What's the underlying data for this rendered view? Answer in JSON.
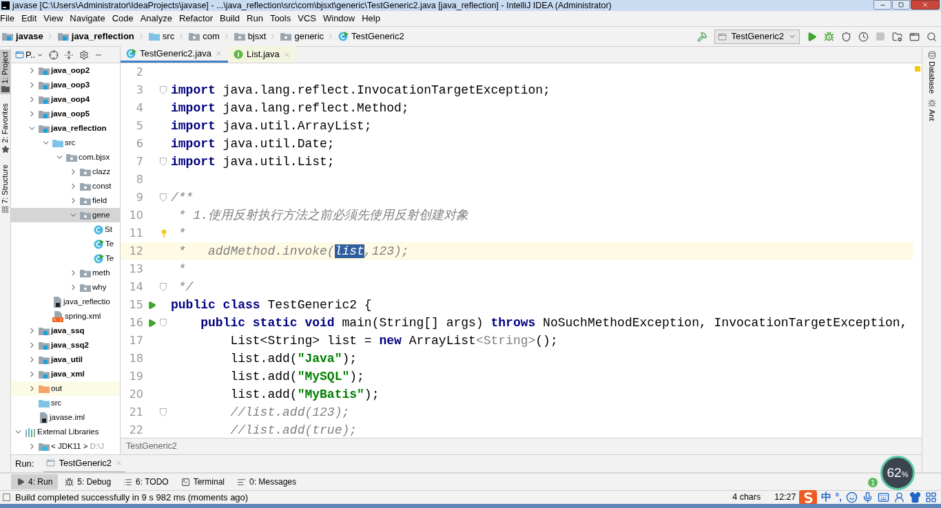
{
  "window": {
    "title": "javase [C:\\Users\\Administrator\\IdeaProjects\\javase] - ...\\java_reflection\\src\\com\\bjsxt\\generic\\TestGeneric2.java [java_reflection] - IntelliJ IDEA (Administrator)"
  },
  "menu": [
    "File",
    "Edit",
    "View",
    "Navigate",
    "Code",
    "Analyze",
    "Refactor",
    "Build",
    "Run",
    "Tools",
    "VCS",
    "Window",
    "Help"
  ],
  "breadcrumb": [
    {
      "label": "javase",
      "kind": "module"
    },
    {
      "label": "java_reflection",
      "kind": "module"
    },
    {
      "label": "src",
      "kind": "src"
    },
    {
      "label": "com",
      "kind": "package"
    },
    {
      "label": "bjsxt",
      "kind": "package"
    },
    {
      "label": "generic",
      "kind": "package"
    },
    {
      "label": "TestGeneric2",
      "kind": "class-run"
    }
  ],
  "run_config": "TestGeneric2",
  "left_tool_tabs": [
    {
      "label": "1: Project",
      "selected": true
    },
    {
      "label": "2: Favorites",
      "selected": false
    },
    {
      "label": "7: Structure",
      "selected": false
    }
  ],
  "right_tool_tabs": [
    {
      "label": "Database",
      "kind": "database"
    },
    {
      "label": "Ant",
      "kind": "ant"
    }
  ],
  "project_panel": {
    "title": "P.."
  },
  "tree": {
    "module_children": [
      {
        "label": "java_oop2",
        "kind": "module",
        "bold": true,
        "expanded": false
      },
      {
        "label": "java_oop3",
        "kind": "module",
        "bold": true,
        "expanded": false
      },
      {
        "label": "java_oop4",
        "kind": "module",
        "bold": true,
        "expanded": false
      },
      {
        "label": "java_oop5",
        "kind": "module",
        "bold": true,
        "expanded": false
      },
      {
        "label": "java_reflection",
        "kind": "module",
        "bold": true,
        "expanded": true,
        "children": [
          {
            "label": "src",
            "kind": "src",
            "expanded": true,
            "children": [
              {
                "label": "com.bjsx",
                "kind": "package",
                "expanded": true,
                "children": [
                  {
                    "label": "clazz",
                    "kind": "package",
                    "expanded": false
                  },
                  {
                    "label": "const",
                    "kind": "package",
                    "expanded": false
                  },
                  {
                    "label": "field",
                    "kind": "package",
                    "expanded": false
                  },
                  {
                    "label": "gene",
                    "kind": "package",
                    "expanded": true,
                    "selected": true,
                    "children": [
                      {
                        "label": "St",
                        "kind": "class"
                      },
                      {
                        "label": "Te",
                        "kind": "class-run"
                      },
                      {
                        "label": "Te",
                        "kind": "class-run"
                      }
                    ]
                  },
                  {
                    "label": "meth",
                    "kind": "package",
                    "expanded": false
                  },
                  {
                    "label": "why",
                    "kind": "package",
                    "expanded": false
                  }
                ]
              }
            ]
          },
          {
            "label": "java_reflectio",
            "kind": "iml"
          },
          {
            "label": "spring.xml",
            "kind": "xml"
          }
        ]
      },
      {
        "label": "java_ssq",
        "kind": "module",
        "bold": true,
        "expanded": false
      },
      {
        "label": "java_ssq2",
        "kind": "module",
        "bold": true,
        "expanded": false
      },
      {
        "label": "java_util",
        "kind": "module",
        "bold": true,
        "expanded": false
      },
      {
        "label": "java_xml",
        "kind": "module",
        "bold": true,
        "expanded": false
      },
      {
        "label": "out",
        "kind": "out",
        "expanded": false,
        "excluded": true
      },
      {
        "label": "src",
        "kind": "src"
      },
      {
        "label": "javase.iml",
        "kind": "iml"
      }
    ],
    "roots": [
      {
        "label": "External Libraries",
        "kind": "libraries",
        "expanded": true,
        "children": [
          {
            "label": "< JDK11 >",
            "detail": "D:\\J",
            "kind": "jdk",
            "expanded": false
          }
        ]
      }
    ]
  },
  "tabs": [
    {
      "label": "TestGeneric2.java",
      "kind": "class-run",
      "selected": true
    },
    {
      "label": "List.java",
      "kind": "interface",
      "selected": false
    }
  ],
  "code": [
    {
      "number": "2"
    },
    {
      "number": "3",
      "fold": true,
      "tokens": [
        {
          "kind": "kw",
          "text": "import"
        },
        {
          "kind": "plain",
          "text": " java.lang.reflect.InvocationTargetException;"
        }
      ]
    },
    {
      "number": "4",
      "tokens": [
        {
          "kind": "kw",
          "text": "import"
        },
        {
          "kind": "plain",
          "text": " java.lang.reflect.Method;"
        }
      ]
    },
    {
      "number": "5",
      "tokens": [
        {
          "kind": "kw",
          "text": "import"
        },
        {
          "kind": "plain",
          "text": " java.util.ArrayList;"
        }
      ]
    },
    {
      "number": "6",
      "tokens": [
        {
          "kind": "kw",
          "text": "import"
        },
        {
          "kind": "plain",
          "text": " java.util.Date;"
        }
      ]
    },
    {
      "number": "7",
      "fold": true,
      "tokens": [
        {
          "kind": "kw",
          "text": "import"
        },
        {
          "kind": "plain",
          "text": " java.util.List;"
        }
      ]
    },
    {
      "number": "8"
    },
    {
      "number": "9",
      "fold": true,
      "tokens": [
        {
          "kind": "doc",
          "text": "/**"
        }
      ]
    },
    {
      "number": "10",
      "tokens": [
        {
          "kind": "doc",
          "text": " * 1.使用反射执行方法之前必须先使用反射创建对象"
        }
      ]
    },
    {
      "number": "11",
      "intention": true,
      "tokens": [
        {
          "kind": "doc",
          "text": " *"
        }
      ]
    },
    {
      "number": "12",
      "current": true,
      "tokens": [
        {
          "kind": "doc",
          "text": " *   addMethod.invoke("
        },
        {
          "kind": "sel",
          "text": "list"
        },
        {
          "kind": "doc",
          "text": ",123);"
        }
      ]
    },
    {
      "number": "13",
      "tokens": [
        {
          "kind": "doc",
          "text": " *"
        }
      ]
    },
    {
      "number": "14",
      "fold": true,
      "tokens": [
        {
          "kind": "doc",
          "text": " */"
        }
      ]
    },
    {
      "number": "15",
      "run": true,
      "tokens": [
        {
          "kind": "kw",
          "text": "public class"
        },
        {
          "kind": "plain",
          "text": " TestGeneric2 {"
        }
      ]
    },
    {
      "number": "16",
      "run": true,
      "fold": true,
      "tokens": [
        {
          "kind": "kw",
          "text": "    public static void"
        },
        {
          "kind": "plain",
          "text": " main(String[] args) "
        },
        {
          "kind": "kw",
          "text": "throws"
        },
        {
          "kind": "plain",
          "text": " NoSuchMethodException, InvocationTargetException,"
        }
      ]
    },
    {
      "number": "17",
      "tokens": [
        {
          "kind": "plain",
          "text": "        List<String> list = "
        },
        {
          "kind": "kw",
          "text": "new"
        },
        {
          "kind": "plain",
          "text": " ArrayList"
        },
        {
          "kind": "grey",
          "text": "<String>"
        },
        {
          "kind": "plain",
          "text": "();"
        }
      ]
    },
    {
      "number": "18",
      "tokens": [
        {
          "kind": "plain",
          "text": "        list.add("
        },
        {
          "kind": "str",
          "text": "\"Java\""
        },
        {
          "kind": "plain",
          "text": ");"
        }
      ]
    },
    {
      "number": "19",
      "tokens": [
        {
          "kind": "plain",
          "text": "        list.add("
        },
        {
          "kind": "str",
          "text": "\"MySQL\""
        },
        {
          "kind": "plain",
          "text": ");"
        }
      ]
    },
    {
      "number": "20",
      "tokens": [
        {
          "kind": "plain",
          "text": "        list.add("
        },
        {
          "kind": "str",
          "text": "\"MyBatis\""
        },
        {
          "kind": "plain",
          "text": ");"
        }
      ]
    },
    {
      "number": "21",
      "fold": true,
      "tokens": [
        {
          "kind": "comment",
          "text": "        //list.add(123);"
        }
      ]
    },
    {
      "number": "22",
      "tokens": [
        {
          "kind": "comment",
          "text": "        //list.add(true);"
        }
      ]
    }
  ],
  "editor_breadcrumb": "TestGeneric2",
  "run_panel": {
    "label": "Run:",
    "tab": "TestGeneric2"
  },
  "tool_buttons": [
    {
      "label": "4: Run",
      "kind": "run",
      "selected": true
    },
    {
      "label": "5: Debug",
      "kind": "debug",
      "selected": false
    },
    {
      "label": "6: TODO",
      "kind": "todo",
      "selected": false
    },
    {
      "label": "Terminal",
      "kind": "terminal",
      "selected": false
    },
    {
      "label": "0: Messages",
      "kind": "messages",
      "selected": false
    }
  ],
  "status": {
    "message": "Build completed successfully in 9 s 982 ms (moments ago)",
    "selection": "4 chars",
    "position": "12:27"
  },
  "ime": {
    "mode": "中",
    "punctuation": "°,"
  },
  "meter": {
    "value": "62",
    "unit": "%",
    "badge": "1"
  }
}
